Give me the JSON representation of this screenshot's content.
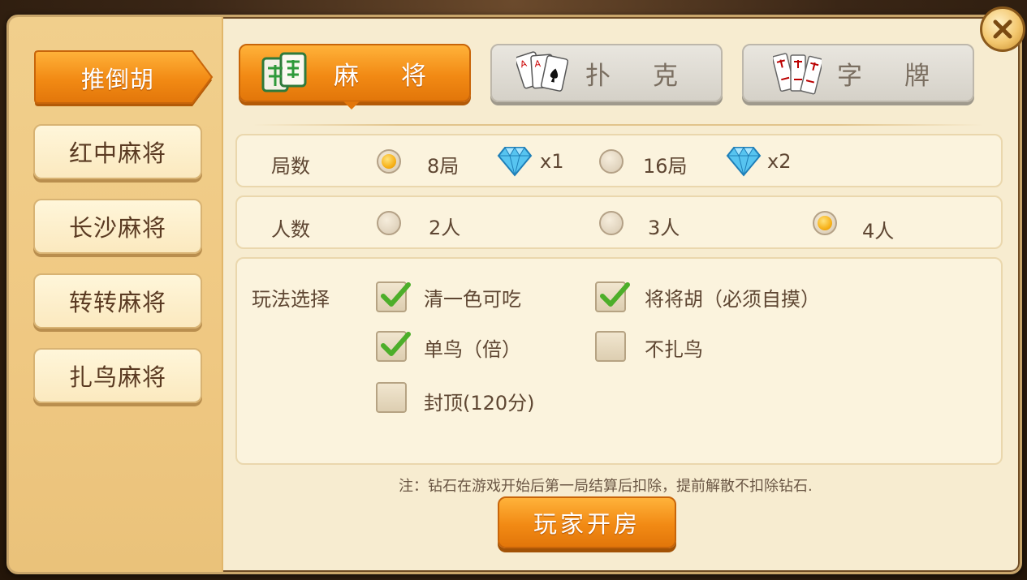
{
  "sidebar": {
    "active": "推倒胡",
    "items": [
      "红中麻将",
      "长沙麻将",
      "转转麻将",
      "扎鸟麻将"
    ]
  },
  "tabs": [
    {
      "label": "麻将",
      "icon": "mahjong-tile-icon",
      "active": true
    },
    {
      "label": "扑克",
      "icon": "poker-cards-icon",
      "active": false
    },
    {
      "label": "字牌",
      "icon": "zipai-cards-icon",
      "active": false
    }
  ],
  "rounds": {
    "label": "局数",
    "options": [
      {
        "text": "8局",
        "selected": true,
        "cost": "x1"
      },
      {
        "text": "16局",
        "selected": false,
        "cost": "x2"
      }
    ]
  },
  "players": {
    "label": "人数",
    "options": [
      {
        "text": "2人",
        "selected": false
      },
      {
        "text": "3人",
        "selected": false
      },
      {
        "text": "4人",
        "selected": true
      }
    ]
  },
  "rules": {
    "label": "玩法选择",
    "options": [
      {
        "text": "清一色可吃",
        "checked": true
      },
      {
        "text": "将将胡（必须自摸）",
        "checked": true
      },
      {
        "text": "单鸟（倍）",
        "checked": true
      },
      {
        "text": "不扎鸟",
        "checked": false
      },
      {
        "text": "封顶(120分)",
        "checked": false
      }
    ]
  },
  "note": "注：钻石在游戏开始后第一局结算后扣除，提前解散不扣除钻石.",
  "create_button": "玩家开房",
  "colors": {
    "accent": "#f28a14",
    "panel": "#f7ecd0",
    "sidebar": "#efc882"
  }
}
